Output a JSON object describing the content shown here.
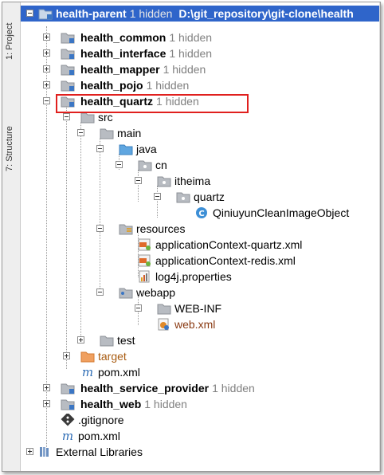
{
  "sidebar": {
    "project_tab": "1: Project",
    "structure_tab": "7: Structure"
  },
  "tree": {
    "root": {
      "name": "health-parent",
      "hidden": "1 hidden",
      "path": "D:\\git_repository\\git-clone\\health"
    },
    "modules": [
      {
        "name": "health_common",
        "hidden": "1 hidden"
      },
      {
        "name": "health_interface",
        "hidden": "1 hidden"
      },
      {
        "name": "health_mapper",
        "hidden": "1 hidden"
      },
      {
        "name": "health_pojo",
        "hidden": "1 hidden"
      },
      {
        "name": "health_quartz",
        "hidden": "1 hidden"
      }
    ],
    "quartz_children": {
      "src": "src",
      "main": "main",
      "java": "java",
      "cn": "cn",
      "itheima": "itheima",
      "quartz_pkg": "quartz",
      "class_file": "QiniuyunCleanImageObject",
      "resources": "resources",
      "res_files": [
        "applicationContext-quartz.xml",
        "applicationContext-redis.xml",
        "log4j.properties"
      ],
      "webapp": "webapp",
      "webinf": "WEB-INF",
      "webxml": "web.xml",
      "test": "test",
      "target": "target",
      "pom": "pom.xml"
    },
    "more_modules": [
      {
        "name": "health_service_provider",
        "hidden": "1 hidden"
      },
      {
        "name": "health_web",
        "hidden": "1 hidden"
      }
    ],
    "root_files": [
      ".gitignore",
      "pom.xml"
    ],
    "external": "External Libraries"
  },
  "colors": {
    "selection": "#2f65ca",
    "highlight_box": "#e0201e",
    "hidden_text": "#808080",
    "target_text": "#a85b10",
    "webxml_text": "#8a3a12"
  }
}
